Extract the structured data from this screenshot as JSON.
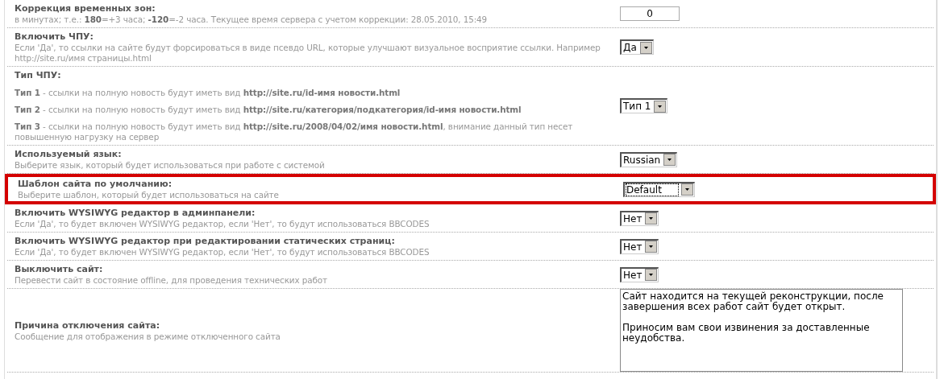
{
  "settings": [
    {
      "title": "Коррекция временных зон:",
      "lines": [
        "в минутах; т.е.: **180**=+3 часа; **-120**=-2 часа. Текущее время сервера с учетом коррекции: 28.05.2010, 15:49"
      ],
      "control": {
        "kind": "input",
        "value": "0"
      },
      "highlighted": false
    },
    {
      "title": "Включить ЧПУ:",
      "lines": [
        "Если 'Да', то ссылки на сайте будут форсироваться в виде псевдо URL, которые улучшают визуальное восприятие ссылки. Например http://site.ru/имя страницы.html"
      ],
      "control": {
        "kind": "select",
        "value": "Да",
        "focused": false
      },
      "highlighted": false
    },
    {
      "title": "Тип ЧПУ:",
      "lines": [
        "**Тип 1** - ссылки на полную новость будут иметь вид **http://site.ru/id-имя новости.html**",
        "**Тип 2** - ссылки на полную новость будут иметь вид **http://site.ru/категория/подкатегория/id-имя новости.html**",
        "**Тип 3** - ссылки на полную новость будут иметь вид **http://site.ru/2008/04/02/имя новости.html**, внимание данный тип несет повышенную нагрузку на сервер"
      ],
      "control": {
        "kind": "select",
        "value": "Тип 1",
        "focused": false
      },
      "highlighted": false
    },
    {
      "title": "Используемый язык:",
      "lines": [
        "Выберите язык, который будет использоваться при работе с системой"
      ],
      "control": {
        "kind": "select",
        "value": "Russian",
        "focused": false
      },
      "highlighted": false
    },
    {
      "title": "Шаблон сайта по умолчанию:",
      "lines": [
        "Выберите шаблон, который будет использоваться на сайте"
      ],
      "control": {
        "kind": "select",
        "value": "Default",
        "focused": true
      },
      "highlighted": true
    },
    {
      "title": "Включить WYSIWYG редактор в админпанели:",
      "lines": [
        "Если 'Да', то будет включен WYSIWYG редактор, если 'Нет', то будут использоваться BBCODES"
      ],
      "control": {
        "kind": "select",
        "value": "Нет",
        "focused": false
      },
      "highlighted": false
    },
    {
      "title": "Включить WYSIWYG редактор при редактировании статических страниц:",
      "lines": [
        "Если 'Да', то будет включен WYSIWYG редактор, если 'Нет', то будут использоваться BBCODES"
      ],
      "control": {
        "kind": "select",
        "value": "Нет",
        "focused": false
      },
      "highlighted": false
    },
    {
      "title": "Выключить сайт:",
      "lines": [
        "Перевести сайт в состояние offline, для проведения технических работ"
      ],
      "control": {
        "kind": "select",
        "value": "Нет",
        "focused": false
      },
      "highlighted": false
    },
    {
      "title": "Причина отключения сайта:",
      "lines": [
        "Сообщение для отображения в режиме отключенного сайта"
      ],
      "control": {
        "kind": "textarea",
        "value": "Сайт находится на текущей реконструкции, после завершения всех работ сайт будет открыт.\n\nПриносим вам свои извинения за доставленные неудобства."
      },
      "highlighted": false
    }
  ]
}
